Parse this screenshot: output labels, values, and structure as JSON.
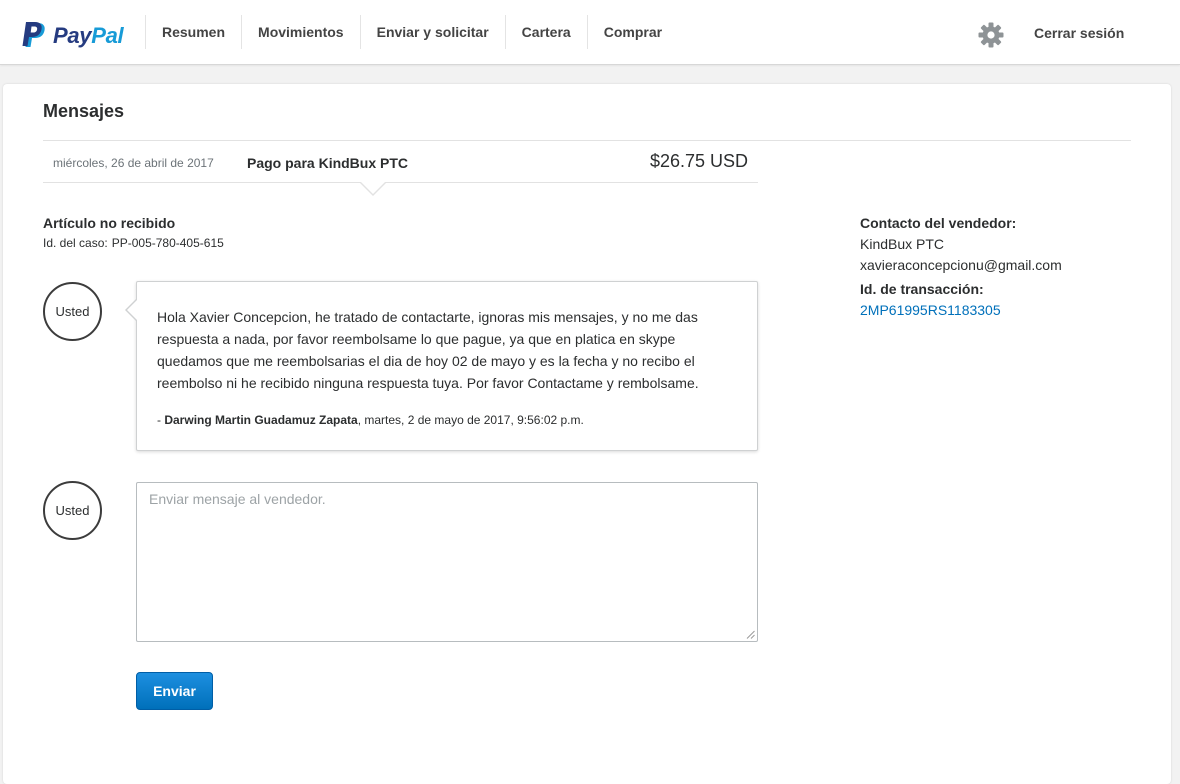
{
  "header": {
    "logo": {
      "pay": "Pay",
      "pal": "Pal"
    },
    "nav": [
      "Resumen",
      "Movimientos",
      "Enviar y solicitar",
      "Cartera",
      "Comprar"
    ],
    "logout": "Cerrar sesión"
  },
  "page": {
    "title": "Mensajes",
    "transaction": {
      "date": "miércoles, 26 de abril de 2017",
      "description": "Pago para KindBux PTC",
      "amount": "$26.75 USD"
    },
    "case": {
      "title": "Artículo no recibido",
      "id_label": "Id. del caso:",
      "id_value": "PP-005-780-405-615"
    },
    "messages": [
      {
        "avatar": "Usted",
        "text": "Hola Xavier Concepcion, he tratado de contactarte, ignoras mis mensajes, y no me das respuesta a nada, por favor reembolsame lo que pague, ya que en platica en skype quedamos que me reembolsarias el dia de hoy 02 de mayo y es la fecha y no recibo el reembolso ni he recibido ninguna respuesta tuya. Por favor Contactame y rembolsame.",
        "sign_prefix": "- ",
        "author": "Darwing Martin Guadamuz Zapata",
        "timestamp": ", martes, 2 de mayo de 2017, 9:56:02 p.m."
      }
    ],
    "compose": {
      "avatar": "Usted",
      "placeholder": "Enviar mensaje al vendedor.",
      "send_label": "Enviar"
    }
  },
  "sidebar": {
    "contact_label": "Contacto del vendedor:",
    "seller_name": "KindBux PTC",
    "seller_email": "xavieraconcepcionu@gmail.com",
    "txn_label": "Id. de transacción:",
    "txn_id": "2MP61995RS1183305"
  },
  "colors": {
    "paypal_dark": "#253b80",
    "paypal_light": "#179bd7",
    "link": "#0070ba",
    "button": "#0070ba"
  }
}
